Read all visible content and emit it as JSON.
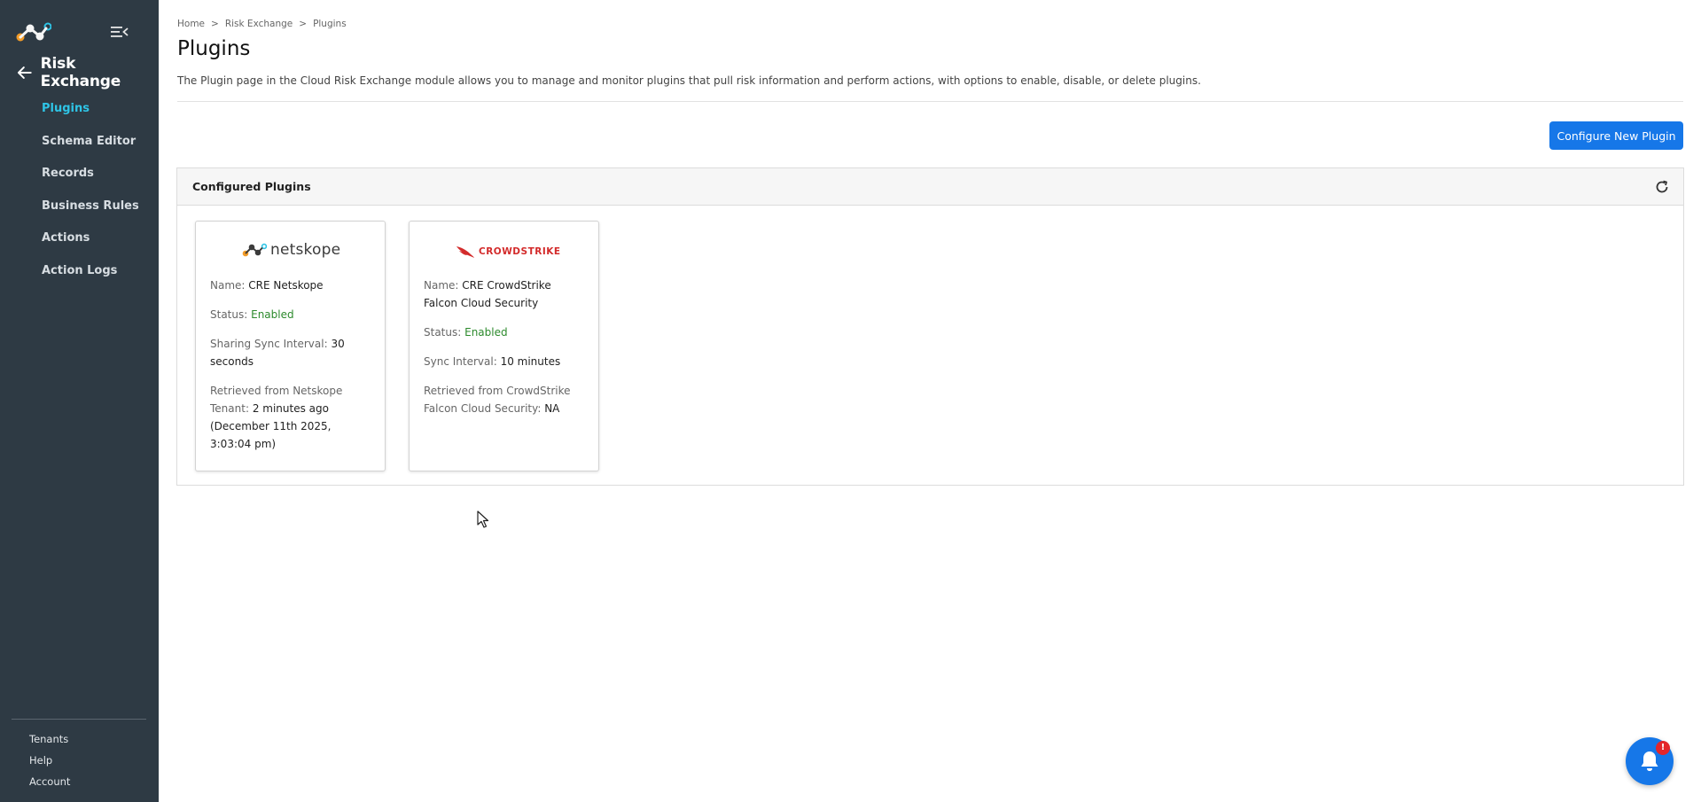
{
  "sidebar": {
    "module_title": "Risk Exchange",
    "items": [
      {
        "label": "Plugins",
        "active": true
      },
      {
        "label": "Schema Editor"
      },
      {
        "label": "Records"
      },
      {
        "label": "Business Rules"
      },
      {
        "label": "Actions"
      },
      {
        "label": "Action Logs"
      }
    ],
    "footer": [
      {
        "label": "Tenants"
      },
      {
        "label": "Help"
      },
      {
        "label": "Account"
      }
    ]
  },
  "breadcrumb": [
    "Home",
    "Risk Exchange",
    "Plugins"
  ],
  "page": {
    "title": "Plugins",
    "description": "The Plugin page in the Cloud Risk Exchange module allows you to manage and monitor plugins that pull risk information and perform actions, with options to enable, disable, or delete plugins.",
    "configure_button": "Configure New Plugin"
  },
  "panel": {
    "title": "Configured Plugins",
    "cards": [
      {
        "logo_word": "netskope",
        "fields": [
          {
            "key": "Name: ",
            "value": "CRE Netskope"
          },
          {
            "key": "Status: ",
            "value": "Enabled"
          },
          {
            "key": "Sharing Sync Interval: ",
            "value": "30 seconds"
          },
          {
            "key": "Retrieved from Netskope Tenant: ",
            "value": "2 minutes ago (December 11th 2025, 3:03:04 pm)"
          }
        ]
      },
      {
        "logo_word": "CROWDSTRIKE",
        "fields": [
          {
            "key": "Name: ",
            "value": "CRE CrowdStrike Falcon Cloud Security"
          },
          {
            "key": "Status: ",
            "value": "Enabled"
          },
          {
            "key": "Sync Interval: ",
            "value": "10 minutes"
          },
          {
            "key": "Retrieved from CrowdStrike Falcon Cloud Security: ",
            "value": "NA"
          }
        ]
      }
    ]
  },
  "notifications": {
    "badge": "!"
  },
  "colors": {
    "sidebar_bg": "#2e3a44",
    "active_nav": "#2ec4e6",
    "primary_button": "#1677e8",
    "enabled_status": "#2c8a2c",
    "badge": "#e3262b"
  },
  "icons": [
    "netskope-logo-icon",
    "collapse-sidebar-icon",
    "back-arrow-icon",
    "refresh-icon",
    "crowdstrike-falcon-icon",
    "bell-icon"
  ]
}
